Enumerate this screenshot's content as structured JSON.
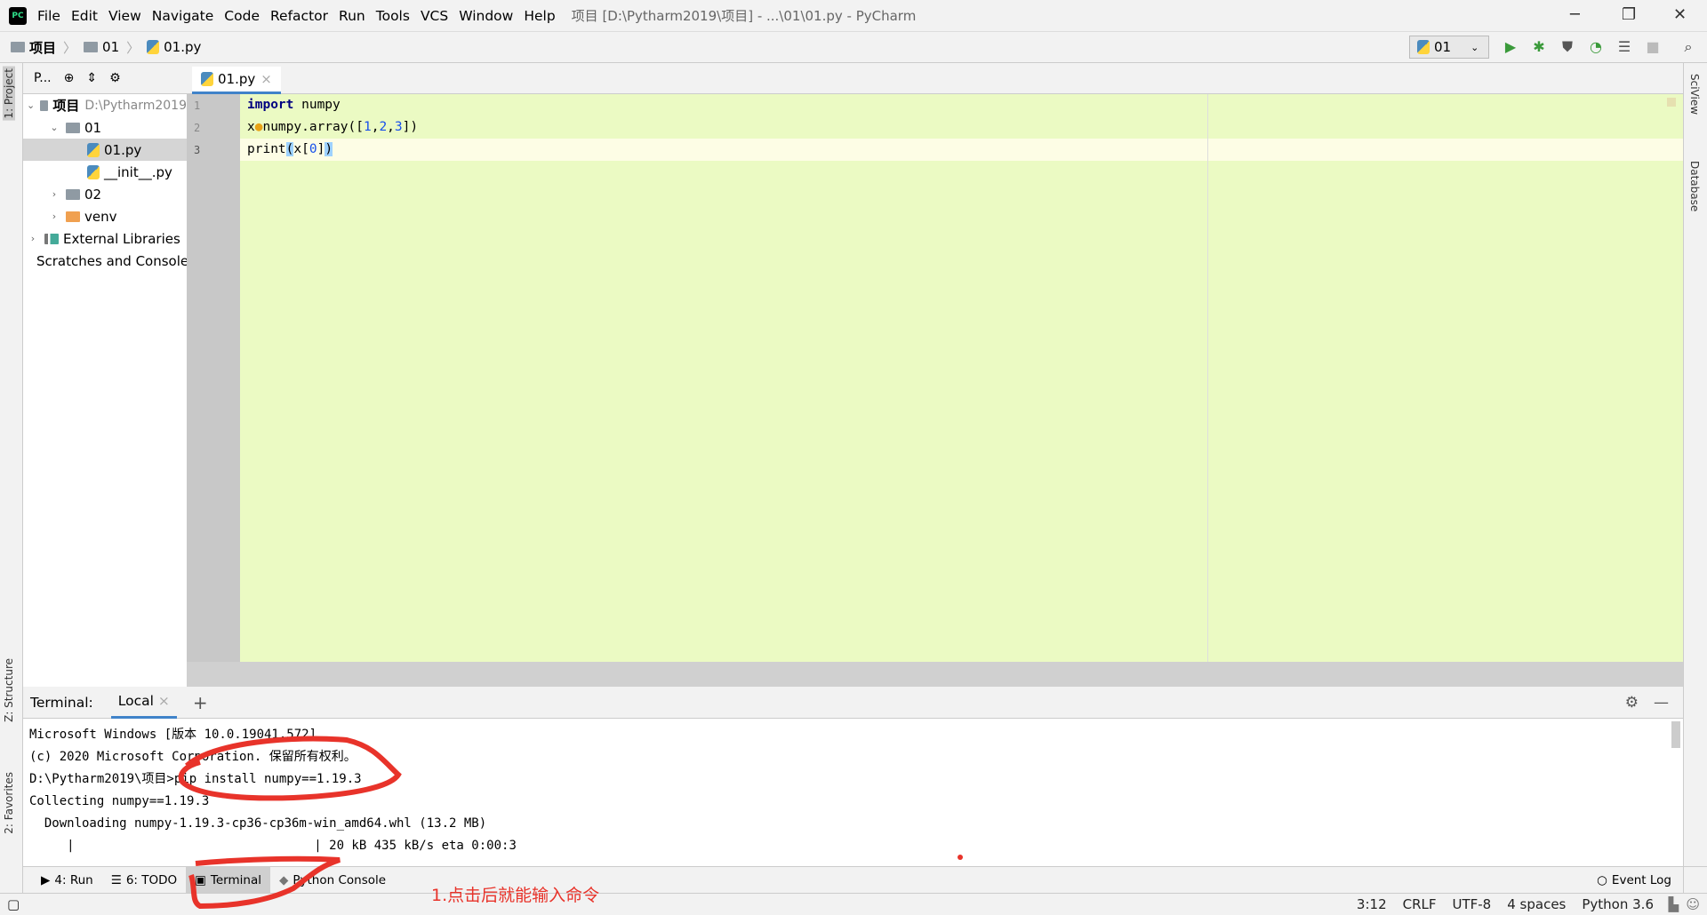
{
  "titlebar": {
    "menu": [
      "File",
      "Edit",
      "View",
      "Navigate",
      "Code",
      "Refactor",
      "Run",
      "Tools",
      "VCS",
      "Window",
      "Help"
    ],
    "title": "项目 [D:\\Pytharm2019\\项目] - ...\\01\\01.py - PyCharm",
    "logo": "PC"
  },
  "breadcrumb": [
    "项目",
    "01",
    "01.py"
  ],
  "toolbar": {
    "run_config": "01"
  },
  "left_stripe": {
    "project": "1: Project",
    "structure": "Z: Structure",
    "favorites": "2: Favorites"
  },
  "right_stripe": {
    "sciview": "SciView",
    "database": "Database"
  },
  "project": {
    "header": "P...",
    "tree": [
      {
        "label": "项目",
        "extra": "D:\\Pytharm2019",
        "level": 0,
        "expanded": true,
        "icon": "folder"
      },
      {
        "label": "01",
        "level": 1,
        "expanded": true,
        "icon": "folder"
      },
      {
        "label": "01.py",
        "level": 2,
        "icon": "python-file",
        "selected": true
      },
      {
        "label": "__init__.py",
        "level": 2,
        "icon": "python-file"
      },
      {
        "label": "02",
        "level": 1,
        "expanded": false,
        "icon": "folder"
      },
      {
        "label": "venv",
        "level": 1,
        "expanded": false,
        "icon": "folder-orange"
      },
      {
        "label": "External Libraries",
        "level": 0,
        "expanded": false,
        "icon": "library"
      },
      {
        "label": "Scratches and Consoles",
        "level": 0,
        "icon": "scratches"
      }
    ]
  },
  "editor": {
    "tab": "01.py",
    "line_numbers": [
      "1",
      "2",
      "3"
    ],
    "lines": [
      {
        "kw": "import",
        "rest": " numpy"
      },
      {
        "text": "x=numpy.array([1,2,3])"
      },
      {
        "text": "print(x[0])"
      }
    ]
  },
  "terminal": {
    "label": "Terminal:",
    "tab": "Local",
    "lines": [
      "Microsoft Windows [版本 10.0.19041.572]",
      "(c) 2020 Microsoft Corporation. 保留所有权利。",
      "D:\\Pytharm2019\\项目>pip install numpy==1.19.3",
      "Collecting numpy==1.19.3",
      "  Downloading numpy-1.19.3-cp36-cp36m-win_amd64.whl (13.2 MB)",
      "     |                                | 20 kB 435 kB/s eta 0:00:3"
    ]
  },
  "bottom_tabs": [
    "4: Run",
    "6: TODO",
    "Terminal",
    "Python Console"
  ],
  "event_log": "Event Log",
  "status": [
    "3:12",
    "CRLF",
    "UTF-8",
    "4 spaces",
    "Python 3.6"
  ],
  "annotation": {
    "note": "1.点击后就能输入命令",
    "color": "#e8332a"
  }
}
